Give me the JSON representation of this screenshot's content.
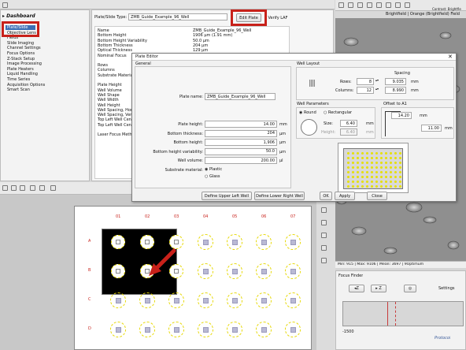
{
  "sidebar": {
    "header": "Dashboard",
    "items": [
      "Plate/Slide",
      "Objective Lens",
      "Fields",
      "Slide Imaging",
      "Channel Settings",
      "Focus Options",
      "Z-Stack Setup",
      "Image Processing",
      "Plate Heaters",
      "Liquid Handling",
      "Time Series",
      "Acquisition Options",
      "Smart Scan"
    ]
  },
  "plate_panel": {
    "type_label": "Plate/Slide Type:",
    "type_value": "ZMB_Guide_Example_96_Well",
    "edit_button": "Edit Plate",
    "verify_button": "Verify LAF",
    "props": [
      {
        "name": "Name",
        "value": "ZMB_Guide_Example_96_Well"
      },
      {
        "name": "Bottom Height",
        "value": "1906 µm (1.91 mm)"
      },
      {
        "name": "Bottom Height Variability",
        "value": "50.0 µm"
      },
      {
        "name": "Bottom Thickness",
        "value": "204 µm"
      },
      {
        "name": "Optical Thickness",
        "value": "129 µm"
      },
      {
        "name": "Nominal Focus",
        "value": ""
      },
      {
        "name": "",
        "value": ""
      },
      {
        "name": "Rows",
        "value": ""
      },
      {
        "name": "Columns",
        "value": ""
      },
      {
        "name": "Substrate Material",
        "value": ""
      },
      {
        "name": "",
        "value": ""
      },
      {
        "name": "Plate Height",
        "value": ""
      },
      {
        "name": "Well Volume",
        "value": ""
      },
      {
        "name": "Well Shape",
        "value": ""
      },
      {
        "name": "Well Width",
        "value": ""
      },
      {
        "name": "Well Height",
        "value": ""
      },
      {
        "name": "Well Spacing, Hor.",
        "value": ""
      },
      {
        "name": "Well Spacing, Ver.",
        "value": ""
      },
      {
        "name": "Top Left Well Center",
        "value": ""
      },
      {
        "name": "Top Left Well Center",
        "value": ""
      },
      {
        "name": "",
        "value": ""
      },
      {
        "name": "Laser Focus Method",
        "value": ""
      }
    ]
  },
  "image_panel": {
    "channel_title": "Brightfield | Orange (Brightfield) Field",
    "contrast_label": "Contrast: Brightfie",
    "stats": "Min:   915 | Max:  9106 | Mean:  3697 | 9Optimum"
  },
  "focus_finder": {
    "title": "Focus Finder",
    "settings": "Settings",
    "z_label": "Z",
    "axis_left": "-1500",
    "protocol": "Protocol"
  },
  "plate_map": {
    "columns": [
      "01",
      "02",
      "03",
      "04",
      "05",
      "06",
      "07"
    ],
    "rows": [
      "A",
      "B",
      "C",
      "D"
    ]
  },
  "dialog": {
    "title": "Plate Editor",
    "general_label": "General",
    "plate_name_label": "Plate name:",
    "plate_name": "ZMB_Guide_Example_96_Well",
    "fields": [
      {
        "label": "Plate height:",
        "value": "14.00",
        "unit": "mm"
      },
      {
        "label": "Bottom thickness:",
        "value": "204",
        "unit": "µm"
      },
      {
        "label": "Bottom height:",
        "value": "1,906",
        "unit": "µm"
      },
      {
        "label": "Bottom height variability:",
        "value": "50.0",
        "unit": "µm"
      },
      {
        "label": "Well volume:",
        "value": "200.00",
        "unit": "µl"
      }
    ],
    "substrate_label": "Substrate material:",
    "substrate_options": [
      "Plastic",
      "Glass"
    ],
    "well_layout": {
      "title": "Well Layout",
      "spacing_label": "Spacing",
      "rows_label": "Rows:",
      "rows": "8",
      "rows_spacing": "9.035",
      "columns_label": "Columns:",
      "columns": "12",
      "columns_spacing": "8.990",
      "unit": "mm"
    },
    "well_params": {
      "title": "Well Parameters",
      "shape_round": "Round",
      "shape_rect": "Rectangular",
      "size_label": "Size:",
      "size": "6.40",
      "height_label": "Height:",
      "height": "6.40",
      "unit": "mm"
    },
    "offset": {
      "title": "Offset to A1",
      "x": "14.20",
      "y": "11.00",
      "unit": "mm"
    },
    "define_ul": "Define Upper Left Well",
    "define_lr": "Define Lower Right Well",
    "ok": "OK",
    "apply": "Apply",
    "close": "Close"
  },
  "colors": {
    "highlight": "#c8211a",
    "selection": "#3b6fb6",
    "well_ring": "#e6d800",
    "plate_bg": "#000000"
  }
}
